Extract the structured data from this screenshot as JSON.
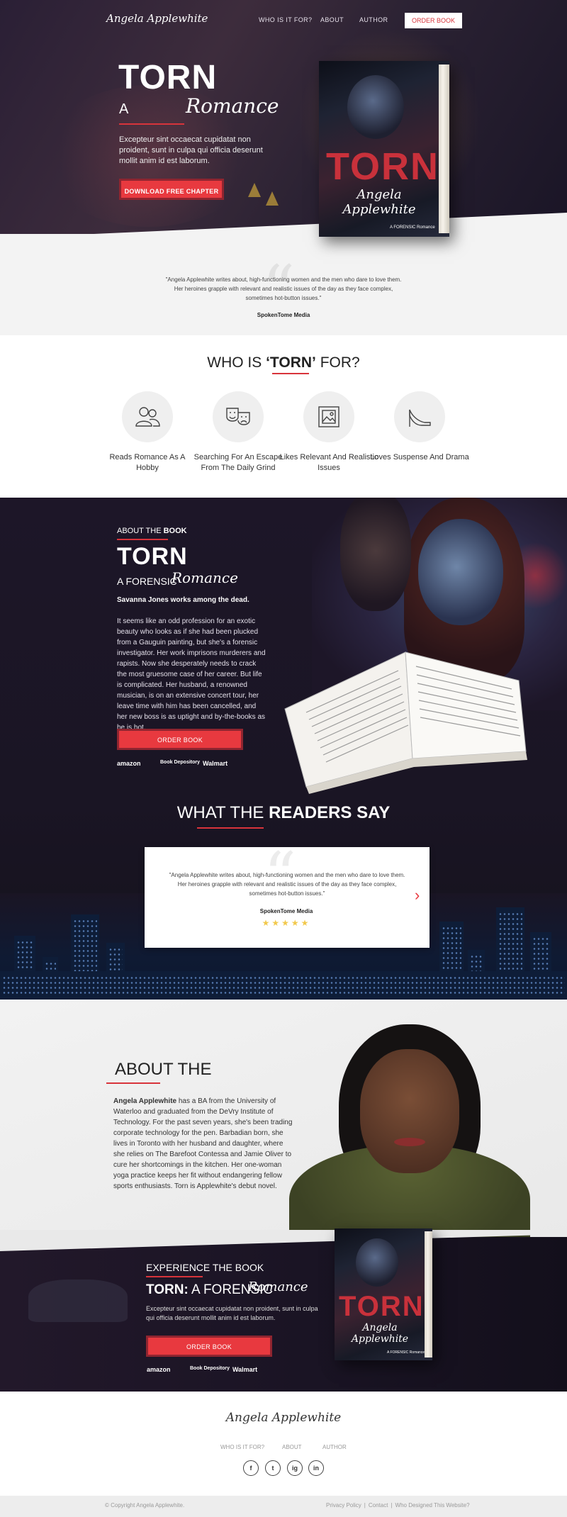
{
  "nav": {
    "logo": "Angela Applewhite",
    "links": [
      "WHO IS IT FOR?",
      "ABOUT",
      "AUTHOR"
    ],
    "order_button": "ORDER BOOK"
  },
  "hero": {
    "title": "TORN",
    "subtitle_a": "A",
    "subtitle_script": "Romance",
    "text": "Excepteur sint occaecat cupidatat non proident, sunt in culpa qui officia deserunt mollit anim id est laborum.",
    "button": "DOWNLOAD FREE CHAPTER"
  },
  "book_cover": {
    "title": "TORN",
    "author": "Angela Applewhite",
    "tag": "A FORENSIC Romance"
  },
  "top_quote": {
    "text": "\"Angela Applewhite writes about, high-functioning women and the men who dare to love them. Her heroines grapple with relevant and realistic issues of the day as they face complex, sometimes hot-button issues.\"",
    "source": "SpokenTome Media"
  },
  "who": {
    "title_prefix": "WHO IS ",
    "title_bold": "‘TORN’",
    "title_suffix": " FOR?",
    "items": [
      {
        "label": "Reads Romance As A Hobby",
        "icon": "people-icon"
      },
      {
        "label": "Searching For An Escape From The Daily Grind",
        "icon": "theater-masks-icon"
      },
      {
        "label": "Likes Relevant And Realistic Issues",
        "icon": "picture-frame-icon"
      },
      {
        "label": "Loves Suspense And Drama",
        "icon": "high-heel-icon"
      }
    ]
  },
  "about_book": {
    "label_prefix": "ABOUT THE ",
    "label_bold": "BOOK",
    "title": "TORN",
    "forensic": "A FORENSIC",
    "romance": "Romance",
    "lead": "Savanna Jones works among the dead.",
    "body": "It seems like an odd profession for an exotic beauty who looks as if she had been plucked from a Gauguin painting, but she's a forensic investigator. Her work imprisons murderers and rapists. Now she desperately needs to crack the most gruesome case of her career. But life is complicated. Her husband, a renowned musician, is on an extensive concert tour, her leave time with him has been cancelled, and her new boss is as uptight and by-the-books as he is hot.",
    "button": "ORDER BOOK",
    "retailers": [
      "amazon",
      "Book Depository",
      "Walmart"
    ]
  },
  "readers": {
    "title_prefix": "WHAT THE ",
    "title_bold": "READERS SAY",
    "review_text": "\"Angela Applewhite writes about, high-functioning women and the men who dare to love them. Her heroines grapple with relevant and realistic issues of the day as they face complex, sometimes hot-button issues.\"",
    "review_source": "SpokenTome Media",
    "stars": "★★★★★",
    "prev_arrow": "‹",
    "next_arrow": "›"
  },
  "author": {
    "title": "ABOUT THE",
    "name_bold": "Angela Applewhite",
    "body": " has a BA from the University of Waterloo and graduated from the DeVry Institute of Technology. For the past seven years, she's been trading corporate technology for the pen. Barbadian born, she lives in Toronto with her husband and daughter, where she relies on The Barefoot Contessa and Jamie Oliver to cure her shortcomings in the kitchen. Her one-woman yoga practice keeps her fit without endangering fellow sports enthusiasts. Torn is Applewhite's debut novel."
  },
  "experience": {
    "label": "EXPERIENCE THE BOOK",
    "title_bold": "TORN:",
    "title_rest": " A FORENSIC",
    "romance": "Romance",
    "text": "Excepteur sint occaecat cupidatat non proident, sunt in culpa qui officia deserunt mollit anim id est laborum.",
    "button": "ORDER BOOK",
    "retailers": [
      "amazon",
      "Book Depository",
      "Walmart"
    ]
  },
  "footer": {
    "logo": "Angela Applewhite",
    "links": [
      "WHO IS IT FOR?",
      "ABOUT",
      "AUTHOR"
    ],
    "social": [
      "f",
      "t",
      "ig",
      "in"
    ],
    "copyright": "© Copyright Angela Applewhite.",
    "bottom_links": [
      "Privacy Policy",
      "Contact",
      "Who Designed This Website?"
    ]
  },
  "colors": {
    "accent": "#e8393f",
    "dark_bg": "#1d1628",
    "light_bg": "#f3f3f3"
  }
}
